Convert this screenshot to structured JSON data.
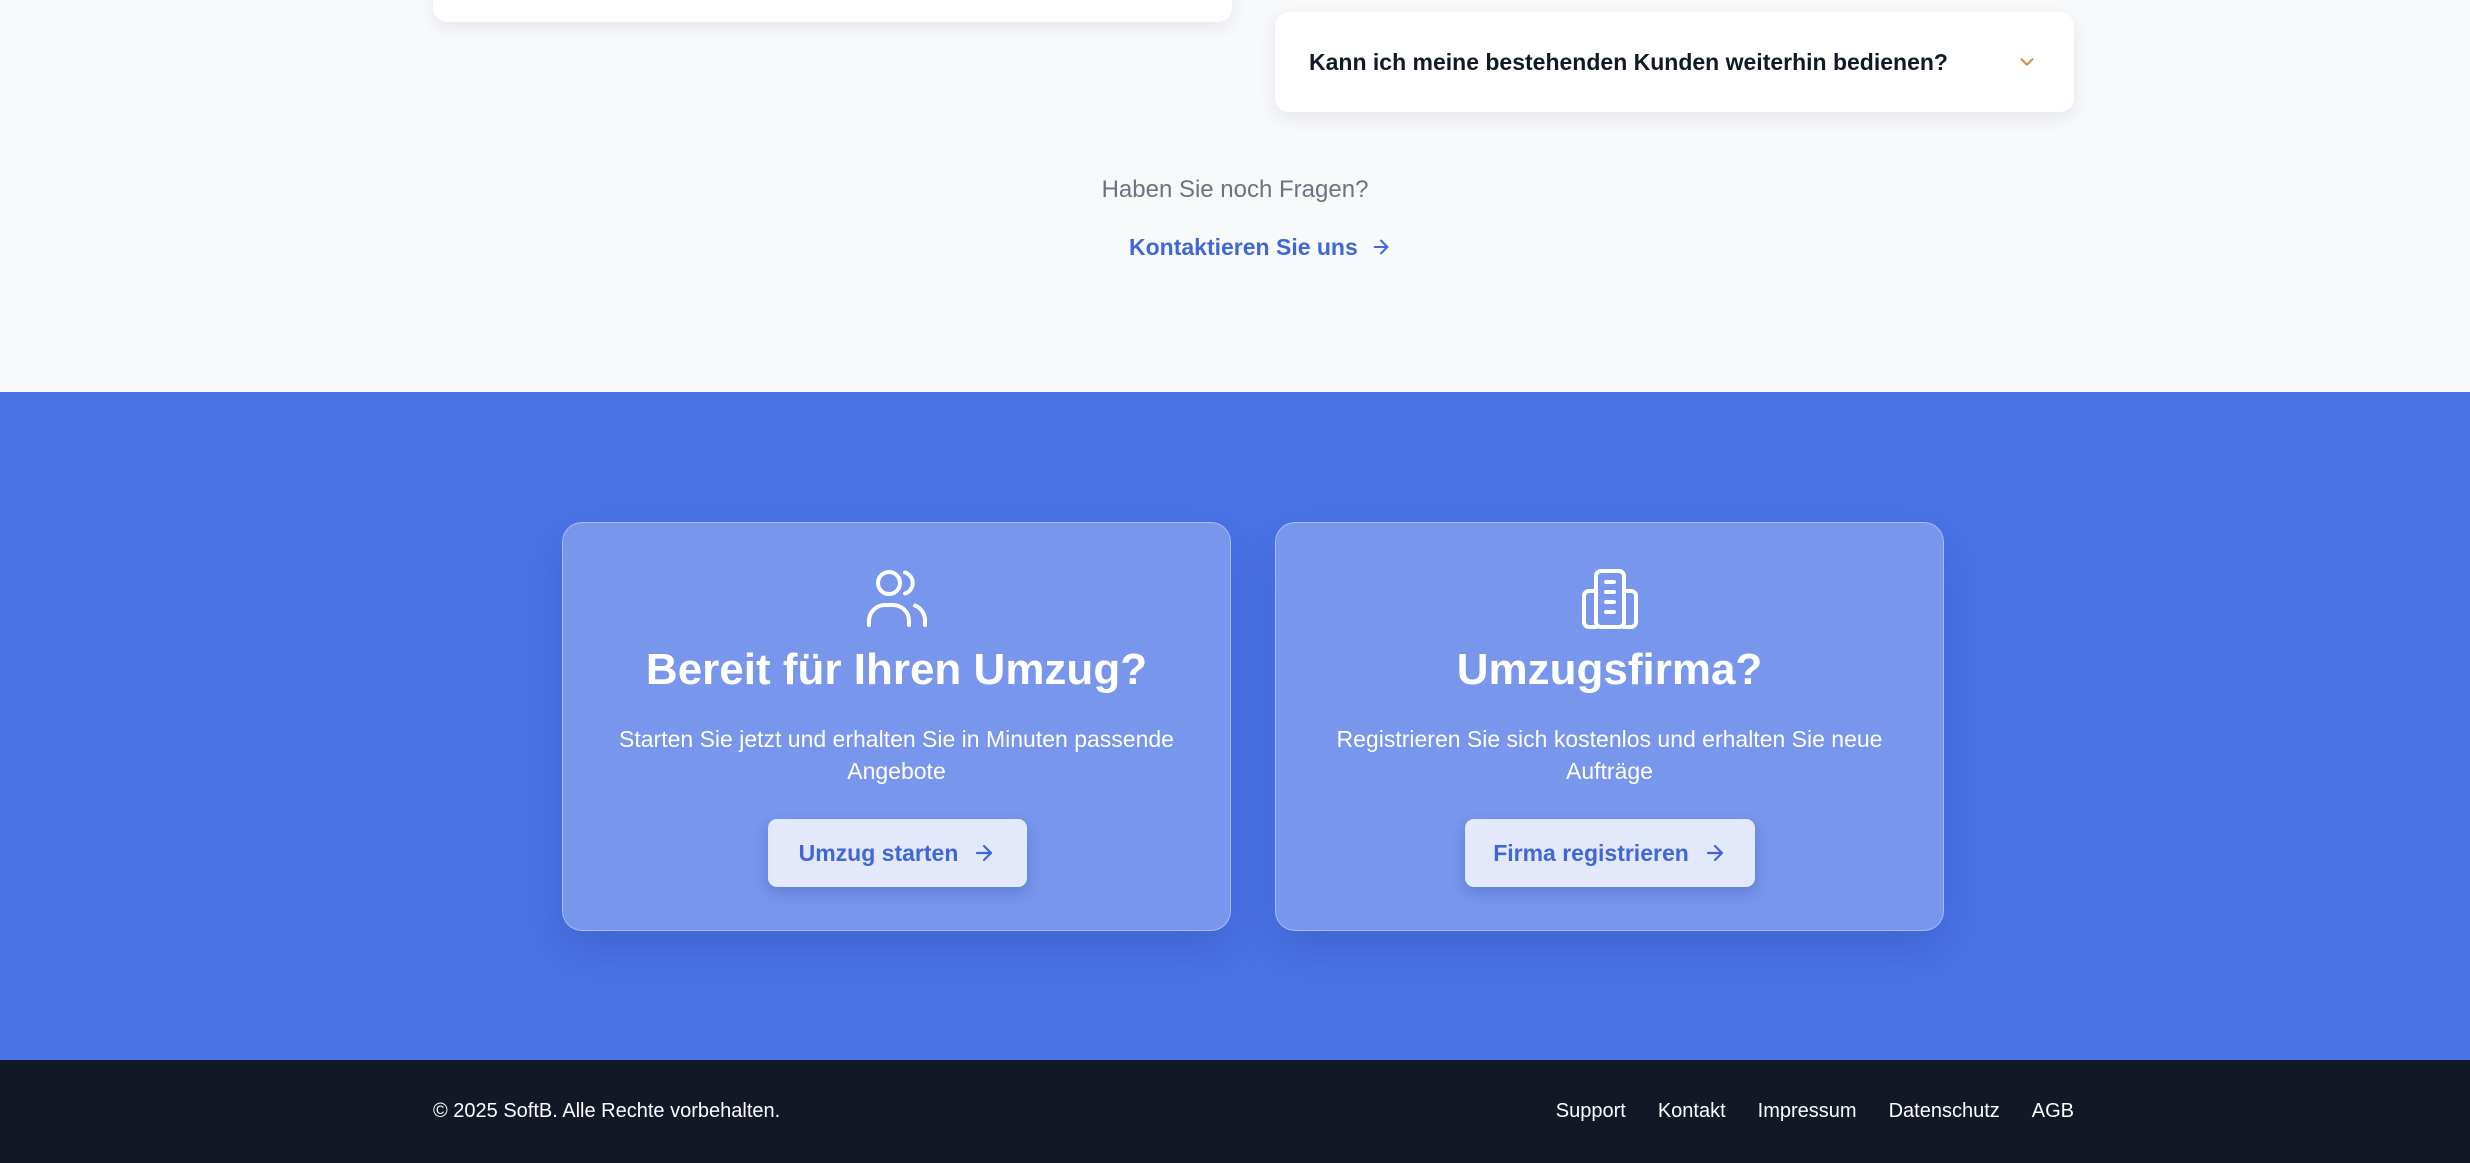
{
  "faq": {
    "question": "Kann ich meine bestehenden Kunden weiterhin bedienen?",
    "more_questions": "Haben Sie noch Fragen?",
    "contact_label": "Kontaktieren Sie uns"
  },
  "cta": {
    "customer": {
      "icon": "users-icon",
      "title": "Bereit für Ihren Umzug?",
      "text": "Starten Sie jetzt und erhalten Sie in Minuten passende Angebote",
      "button_label": "Umzug starten"
    },
    "company": {
      "icon": "building-icon",
      "title": "Umzugsfirma?",
      "text": "Registrieren Sie sich kostenlos und erhalten Sie neue Aufträge",
      "button_label": "Firma registrieren"
    }
  },
  "footer": {
    "copyright": "© 2025 SoftB. Alle Rechte vorbehalten.",
    "links": [
      "Support",
      "Kontakt",
      "Impressum",
      "Datenschutz",
      "AGB"
    ]
  },
  "colors": {
    "brand_blue": "#4a73e6",
    "link_blue": "#3f67d6",
    "chevron_orange": "#d98c3a",
    "footer_bg": "#121826",
    "page_bg": "#f8f9fb"
  }
}
